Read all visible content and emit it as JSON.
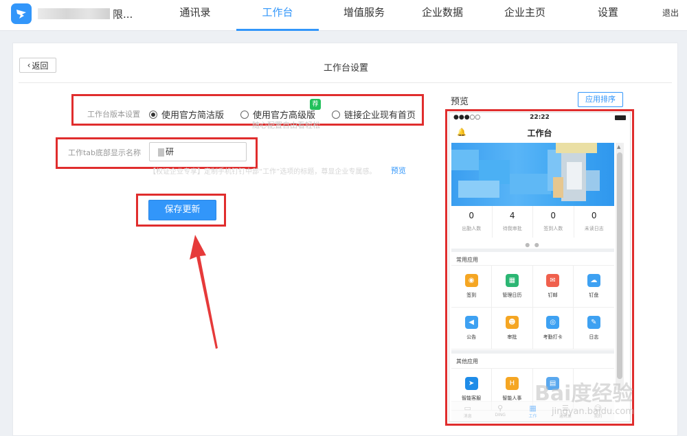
{
  "topnav": {
    "company_suffix": "限...",
    "items": [
      "通讯录",
      "工作台",
      "增值服务",
      "企业数据",
      "企业主页",
      "设置"
    ],
    "active_index": 1,
    "logout": "退出"
  },
  "page": {
    "back_label": "返回",
    "title": "工作台设置"
  },
  "form": {
    "version_label": "工作台版本设置",
    "options": [
      "使用官方简洁版",
      "使用官方高级版",
      "链接企业现有首页"
    ],
    "selected_option": 0,
    "new_badge": "荐",
    "advanced_hint": "随心配置自由看轻松",
    "tab_name_label": "工作tab底部显示名称",
    "tab_name_value": "研",
    "tab_name_hint": "【权证企业专享】定制手机钉钉中部“工作”选项的标题，尊显企业专属感。",
    "preview_link": "预览",
    "save_button": "保存更新"
  },
  "preview": {
    "label": "预览",
    "sort_button": "应用排序",
    "phone": {
      "time": "22:22",
      "signal": "●●●○○",
      "title": "工作台",
      "stats": [
        {
          "value": "0",
          "label": "出勤人数"
        },
        {
          "value": "4",
          "label": "待我审批"
        },
        {
          "value": "0",
          "label": "签到人数"
        },
        {
          "value": "0",
          "label": "未读日志"
        }
      ],
      "pager": "● ●",
      "common_title": "常用应用",
      "common_apps": [
        {
          "name": "签到",
          "icon": "location-pin-icon",
          "color": "#f5a623"
        },
        {
          "name": "管理日历",
          "icon": "calendar-icon",
          "color": "#2bb673"
        },
        {
          "name": "钉邮",
          "icon": "mail-icon",
          "color": "#f0604d"
        },
        {
          "name": "钉盘",
          "icon": "cloud-icon",
          "color": "#3ea1f2"
        },
        {
          "name": "公告",
          "icon": "speaker-icon",
          "color": "#3ea1f2"
        },
        {
          "name": "审批",
          "icon": "person-icon",
          "color": "#f5a623"
        },
        {
          "name": "考勤打卡",
          "icon": "pin-icon",
          "color": "#3ea1f2"
        },
        {
          "name": "日志",
          "icon": "note-icon",
          "color": "#3ea1f2"
        }
      ],
      "other_title": "其他应用",
      "other_apps": [
        {
          "name": "智能客服",
          "icon": "bird-icon",
          "color": "#1f8ce8"
        },
        {
          "name": "智能人事",
          "icon": "h-icon",
          "color": "#f5a623"
        },
        {
          "name": "",
          "icon": "doc-icon",
          "color": "#5aa8ee"
        }
      ],
      "tabs": [
        "消息",
        "DING",
        "工作",
        "通讯录",
        "我的"
      ]
    }
  },
  "watermark": {
    "text": "Bai度经验",
    "url": "jingyan.baidu.com"
  }
}
